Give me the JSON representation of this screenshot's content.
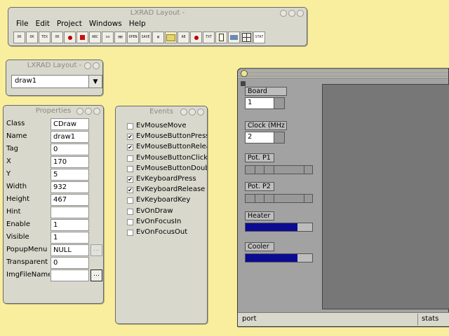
{
  "main_window": {
    "title": "LXRAD Layout -",
    "menu": [
      "File",
      "Edit",
      "Project",
      "Windows",
      "Help"
    ],
    "toolbar_icons": [
      {
        "name": "button-tool-icon",
        "text": "OK"
      },
      {
        "name": "ok-tool-icon",
        "text": "OK"
      },
      {
        "name": "text-tool-icon",
        "text": "TEX"
      },
      {
        "name": "label-tool-icon",
        "text": "OK"
      },
      {
        "name": "draw-tool-icon",
        "text": "✜"
      },
      {
        "name": "record-tool-icon",
        "text": ""
      },
      {
        "name": "edit-tool-icon",
        "text": "ABC"
      },
      {
        "name": "list-tool-icon",
        "text": "≡≡"
      },
      {
        "name": "combo-tool-icon",
        "text": "▤▤"
      },
      {
        "name": "menu-tool-icon",
        "text": "OPEN"
      },
      {
        "name": "save-tool-icon",
        "text": "SAVE"
      },
      {
        "name": "scroll-tool-icon",
        "text": "▥"
      },
      {
        "name": "folder-tool-icon",
        "text": ""
      },
      {
        "name": "font-tool-icon",
        "text": "AB"
      },
      {
        "name": "gear-tool-icon",
        "text": "✥"
      },
      {
        "name": "text2-tool-icon",
        "text": "TXT"
      },
      {
        "name": "checkbox-tool-icon",
        "text": ""
      },
      {
        "name": "image-tool-icon",
        "text": ""
      },
      {
        "name": "grid-tool-icon",
        "text": ""
      },
      {
        "name": "status-tool-icon",
        "text": "STAT"
      }
    ]
  },
  "layout_window": {
    "title": "LXRAD Layout -",
    "selected": "draw1"
  },
  "properties": {
    "title": "Properties",
    "rows": [
      {
        "label": "Class",
        "value": "CDraw"
      },
      {
        "label": "Name",
        "value": "draw1"
      },
      {
        "label": "Tag",
        "value": "0"
      },
      {
        "label": "X",
        "value": "170"
      },
      {
        "label": "Y",
        "value": "5"
      },
      {
        "label": "Width",
        "value": "932"
      },
      {
        "label": "Height",
        "value": "467"
      },
      {
        "label": "Hint",
        "value": ""
      },
      {
        "label": "Enable",
        "value": "1"
      },
      {
        "label": "Visible",
        "value": "1"
      },
      {
        "label": "PopupMenu",
        "value": "NULL"
      },
      {
        "label": "Transparent",
        "value": "0"
      },
      {
        "label": "ImgFileName",
        "value": ""
      }
    ],
    "dots_label": "…"
  },
  "events": {
    "title": "Events",
    "items": [
      {
        "label": "EvMouseMove",
        "checked": false
      },
      {
        "label": "EvMouseButtonPress",
        "checked": true
      },
      {
        "label": "EvMouseButtonRelease",
        "checked": true
      },
      {
        "label": "EvMouseButtonClick",
        "checked": false
      },
      {
        "label": "EvMouseButtonDoubleClick",
        "checked": false
      },
      {
        "label": "EvKeyboardPress",
        "checked": true
      },
      {
        "label": "EvKeyboardRelease",
        "checked": true
      },
      {
        "label": "EvKeyboardKey",
        "checked": false
      },
      {
        "label": "EvOnDraw",
        "checked": false
      },
      {
        "label": "EvOnFocusIn",
        "checked": false
      },
      {
        "label": "EvOnFocusOut",
        "checked": false
      }
    ]
  },
  "board": {
    "board_label": "Board",
    "board_value": "1",
    "clock_label": "Clock (MHz",
    "clock_value": "2",
    "pot1_label": "Pot. P1",
    "pot2_label": "Pot. P2",
    "heater_label": "Heater",
    "heater_level": 0.78,
    "cooler_label": "Cooler",
    "cooler_level": 0.78,
    "fill_color": "#0b0b92",
    "status_left": "port",
    "status_right": "stats"
  }
}
